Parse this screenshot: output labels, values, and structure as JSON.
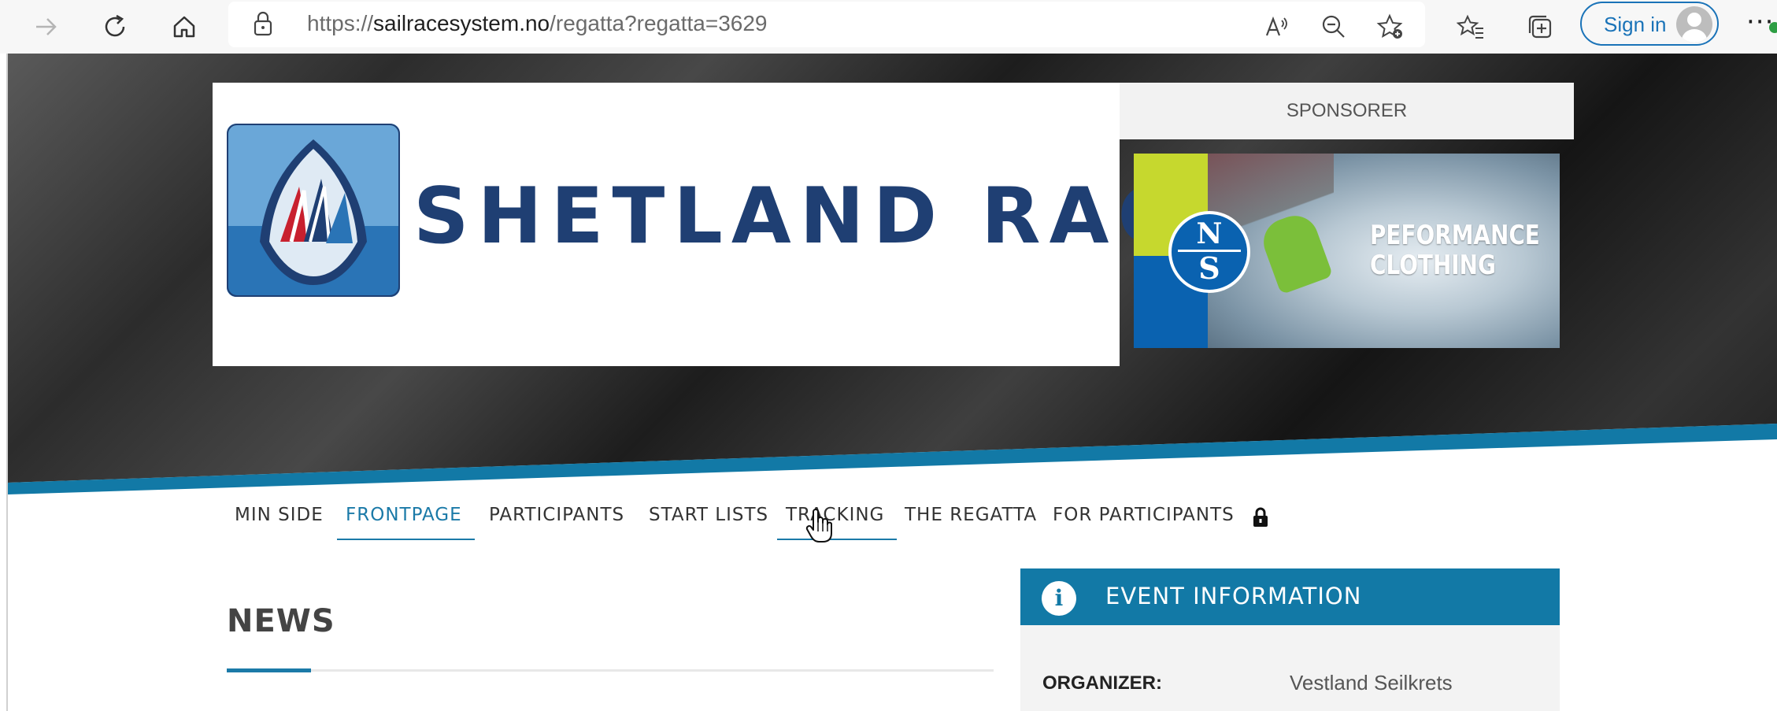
{
  "browser": {
    "url_prefix": "https://",
    "url_host": "sailracesystem.no",
    "url_path": "/regatta?regatta=3629",
    "sign_in_label": "Sign in",
    "more_label": "···",
    "icons": [
      "forward-icon",
      "refresh-icon",
      "home-icon",
      "lock-icon",
      "read-aloud-icon",
      "zoom-out-icon",
      "add-favorite-icon",
      "favorites-icon",
      "collections-icon",
      "profile-icon",
      "more-icon"
    ]
  },
  "header": {
    "brand_name": "SHETLAND RACE",
    "sponsor_label": "SPONSORER",
    "sponsor_ad": {
      "logo_top": "N",
      "logo_bottom": "S",
      "text_line1": "PEFORMANCE",
      "text_line2": "CLOTHING"
    }
  },
  "nav": {
    "items": [
      {
        "label": "MIN SIDE",
        "active": false
      },
      {
        "label": "FRONTPAGE",
        "active": true
      },
      {
        "label": "PARTICIPANTS",
        "active": false
      },
      {
        "label": "START LISTS",
        "active": false
      },
      {
        "label": "TRACKING",
        "active": false,
        "hovered": true
      },
      {
        "label": "THE REGATTA",
        "active": false
      },
      {
        "label": "FOR PARTICIPANTS",
        "active": false
      }
    ],
    "lock_icon": "lock-icon"
  },
  "news": {
    "title": "NEWS"
  },
  "event_info": {
    "title": "EVENT INFORMATION",
    "info_icon_glyph": "i",
    "organizer_label": "ORGANIZER:",
    "organizer_value": "Vestland Seilkrets"
  },
  "colors": {
    "accent": "#1b7aa8",
    "event_header": "#1279a6",
    "brand_navy": "#1f3f73",
    "sign_in_blue": "#1a73b8"
  }
}
